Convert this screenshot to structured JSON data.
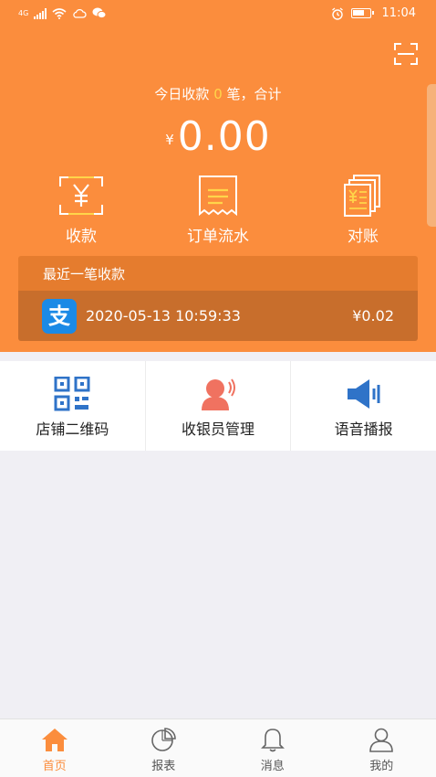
{
  "status_bar": {
    "network": "4G",
    "time": "11:04"
  },
  "header": {
    "scan_icon": "scan-icon",
    "today_prefix": "今日收款",
    "today_count": "0",
    "today_suffix": "笔，合计",
    "currency": "¥",
    "total_amount": "0.00",
    "accent_color": "#fb8d3d"
  },
  "quick_actions": [
    {
      "label": "收款",
      "icon": "receive-payment-icon"
    },
    {
      "label": "订单流水",
      "icon": "receipt-icon"
    },
    {
      "label": "对账",
      "icon": "reconciliation-icon"
    }
  ],
  "recent_payment": {
    "title": "最近一笔收款",
    "method_icon": "alipay-icon",
    "method_glyph": "支",
    "datetime": "2020-05-13 10:59:33",
    "amount": "¥0.02"
  },
  "tools": [
    {
      "label": "店铺二维码",
      "icon": "qr-code-icon"
    },
    {
      "label": "收银员管理",
      "icon": "cashier-icon"
    },
    {
      "label": "语音播报",
      "icon": "speaker-icon"
    }
  ],
  "tab_bar": [
    {
      "label": "首页",
      "icon": "home-icon",
      "active": true
    },
    {
      "label": "报表",
      "icon": "pie-chart-icon",
      "active": false
    },
    {
      "label": "消息",
      "icon": "bell-icon",
      "active": false
    },
    {
      "label": "我的",
      "icon": "user-icon",
      "active": false
    }
  ]
}
